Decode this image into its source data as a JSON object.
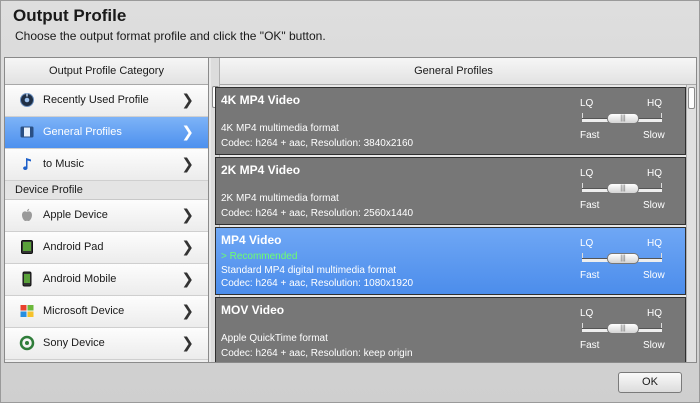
{
  "header": {
    "title": "Output Profile",
    "subtitle": "Choose the output format profile and click the \"OK\" button."
  },
  "left_panel": {
    "heading": "Output Profile Category",
    "items": [
      {
        "label": "Recently Used Profile",
        "icon": "recent-profile-icon",
        "selected": false
      },
      {
        "label": "General Profiles",
        "icon": "general-profiles-icon",
        "selected": true
      },
      {
        "label": "to Music",
        "icon": "music-note-icon",
        "selected": false
      }
    ],
    "device_section": {
      "label": "Device Profile",
      "items": [
        {
          "label": "Apple Device",
          "icon": "apple-icon"
        },
        {
          "label": "Android Pad",
          "icon": "android-pad-icon"
        },
        {
          "label": "Android Mobile",
          "icon": "android-mobile-icon"
        },
        {
          "label": "Microsoft Device",
          "icon": "microsoft-icon"
        },
        {
          "label": "Sony Device",
          "icon": "sony-device-icon"
        }
      ]
    }
  },
  "right_panel": {
    "heading": "General Profiles",
    "profiles": [
      {
        "title": "4K MP4 Video",
        "recommended": "",
        "desc": "4K MP4 multimedia format",
        "codec": "Codec: h264 + aac, Resolution: 3840x2160",
        "selected": false
      },
      {
        "title": "2K MP4 Video",
        "recommended": "",
        "desc": "2K MP4 multimedia format",
        "codec": "Codec: h264 + aac, Resolution: 2560x1440",
        "selected": false
      },
      {
        "title": "MP4 Video",
        "recommended": "> Recommended",
        "desc": "Standard MP4 digital multimedia format",
        "codec": "Codec: h264 + aac, Resolution: 1080x1920",
        "selected": true
      },
      {
        "title": "MOV Video",
        "recommended": "",
        "desc": "Apple QuickTime format",
        "codec": "Codec: h264 + aac, Resolution: keep origin",
        "selected": false
      }
    ],
    "quality_labels": {
      "lq": "LQ",
      "hq": "HQ",
      "fast": "Fast",
      "slow": "Slow"
    }
  },
  "footer": {
    "ok_label": "OK"
  },
  "colors": {
    "selection": "#4d90ee",
    "profile_bg": "#777777",
    "recommended": "#6dff6d"
  }
}
